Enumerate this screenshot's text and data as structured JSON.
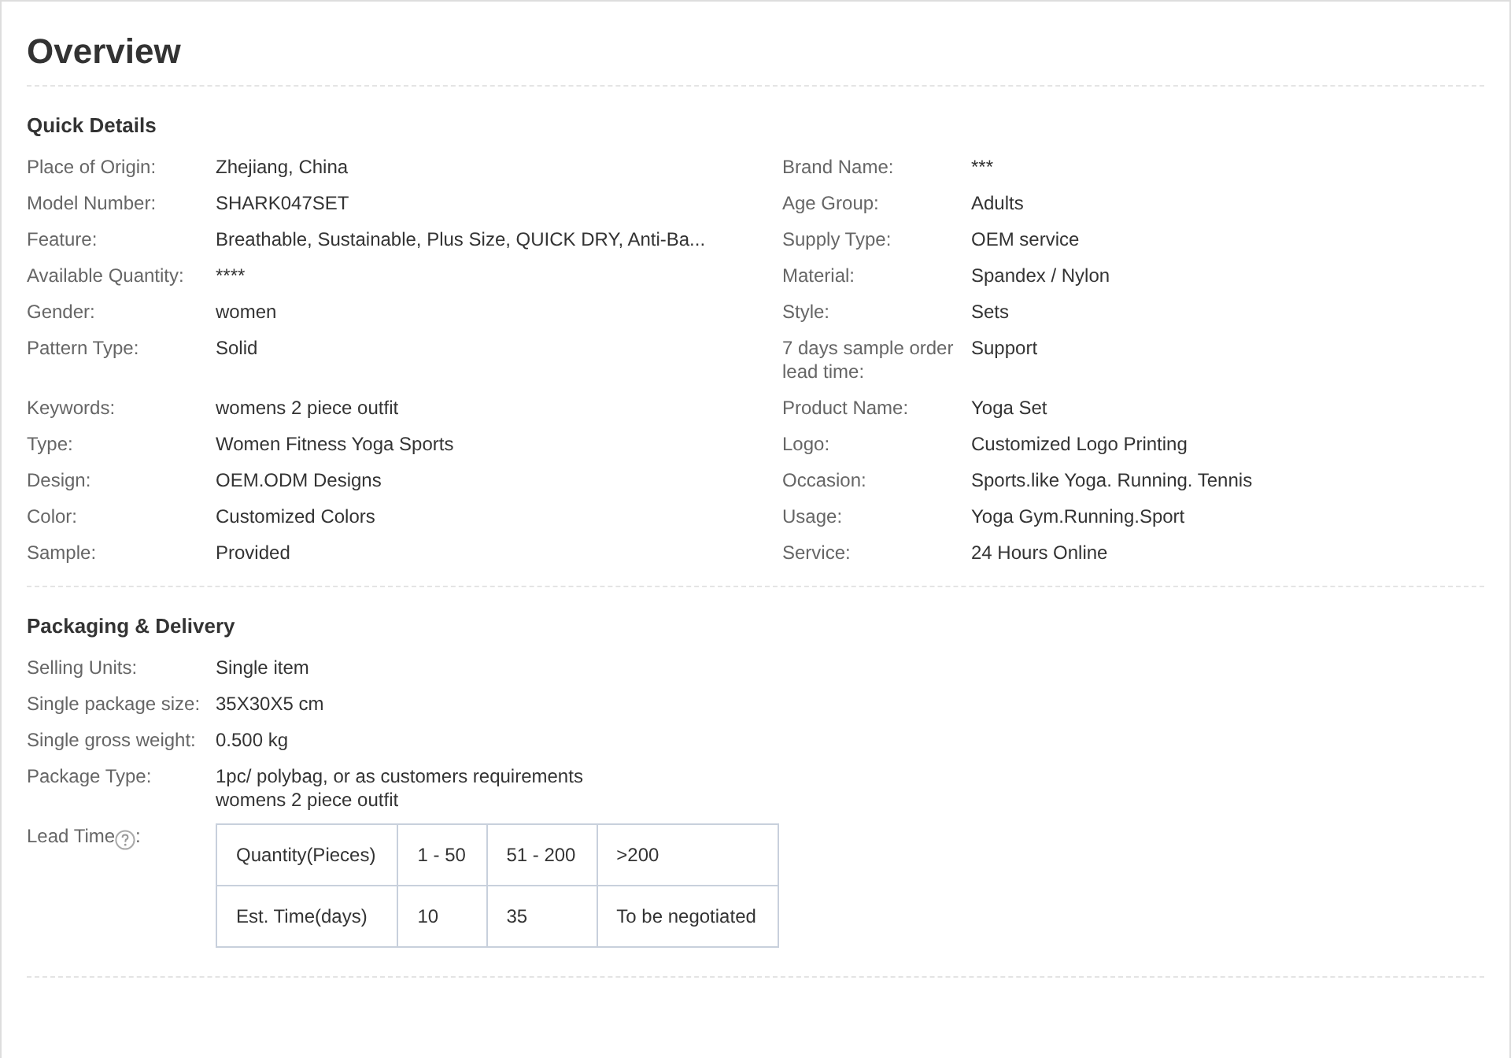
{
  "title": "Overview",
  "quick_details": {
    "heading": "Quick Details",
    "rows": [
      {
        "left": {
          "label": "Place of Origin:",
          "value": "Zhejiang, China"
        },
        "right": {
          "label": "Brand Name:",
          "value": "***"
        }
      },
      {
        "left": {
          "label": "Model Number:",
          "value": "SHARK047SET"
        },
        "right": {
          "label": "Age Group:",
          "value": "Adults"
        }
      },
      {
        "left": {
          "label": "Feature:",
          "value": "Breathable, Sustainable, Plus Size, QUICK DRY, Anti-Ba..."
        },
        "right": {
          "label": "Supply Type:",
          "value": "OEM service"
        }
      },
      {
        "left": {
          "label": "Available Quantity:",
          "value": "****"
        },
        "right": {
          "label": "Material:",
          "value": "Spandex / Nylon"
        }
      },
      {
        "left": {
          "label": "Gender:",
          "value": "women"
        },
        "right": {
          "label": "Style:",
          "value": "Sets"
        }
      },
      {
        "left": {
          "label": "Pattern Type:",
          "value": "Solid"
        },
        "right": {
          "label": "7 days sample order lead time:",
          "value": "Support"
        }
      },
      {
        "left": {
          "label": "Keywords:",
          "value": "womens 2 piece outfit"
        },
        "right": {
          "label": "Product Name:",
          "value": "Yoga Set"
        }
      },
      {
        "left": {
          "label": "Type:",
          "value": "Women Fitness Yoga Sports"
        },
        "right": {
          "label": "Logo:",
          "value": "Customized Logo Printing"
        }
      },
      {
        "left": {
          "label": "Design:",
          "value": "OEM.ODM Designs"
        },
        "right": {
          "label": "Occasion:",
          "value": "Sports.like Yoga. Running. Tennis"
        }
      },
      {
        "left": {
          "label": "Color:",
          "value": "Customized Colors"
        },
        "right": {
          "label": "Usage:",
          "value": "Yoga Gym.Running.Sport"
        }
      },
      {
        "left": {
          "label": "Sample:",
          "value": "Provided"
        },
        "right": {
          "label": "Service:",
          "value": "24 Hours Online"
        }
      }
    ]
  },
  "packaging": {
    "heading": "Packaging & Delivery",
    "rows": [
      {
        "label": "Selling Units:",
        "lines": [
          "Single item"
        ]
      },
      {
        "label": "Single package size:",
        "lines": [
          "35X30X5 cm"
        ]
      },
      {
        "label": "Single gross weight:",
        "lines": [
          "0.500 kg"
        ]
      },
      {
        "label": "Package Type:",
        "lines": [
          "1pc/ polybag, or as customers requirements",
          "womens 2 piece outfit"
        ]
      }
    ],
    "lead_time": {
      "label": "Lead Time",
      "label_suffix": ":",
      "table": [
        [
          "Quantity(Pieces)",
          "1 - 50",
          "51 - 200",
          ">200"
        ],
        [
          "Est. Time(days)",
          "10",
          "35",
          "To be negotiated"
        ]
      ]
    }
  }
}
